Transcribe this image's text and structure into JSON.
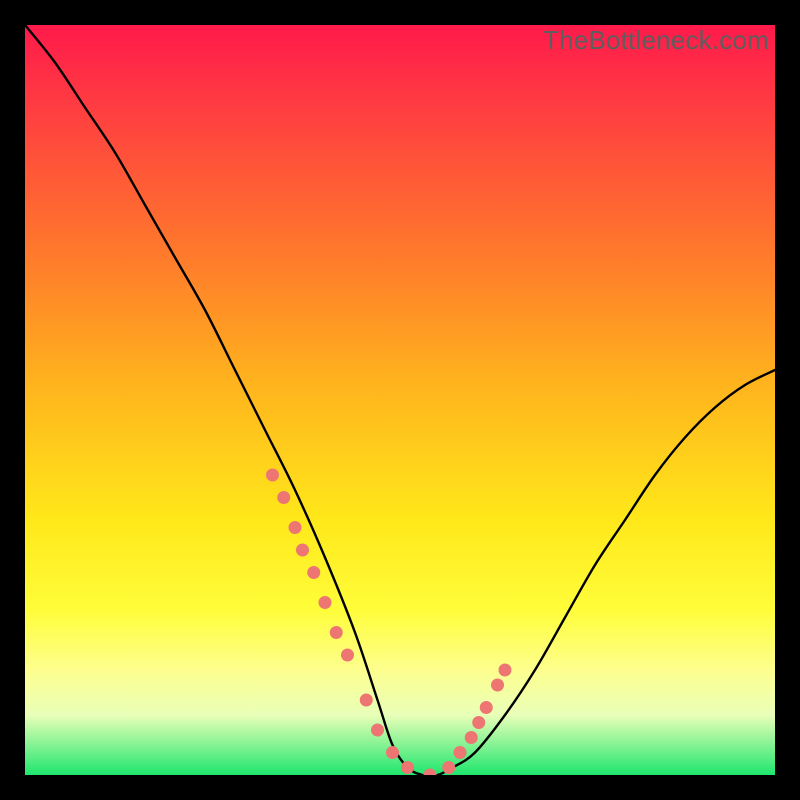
{
  "watermark": "TheBottleneck.com",
  "chart_data": {
    "type": "line",
    "title": "",
    "xlabel": "",
    "ylabel": "",
    "xlim": [
      0,
      100
    ],
    "ylim": [
      0,
      100
    ],
    "series": [
      {
        "name": "bottleneck-curve",
        "x": [
          0,
          4,
          8,
          12,
          16,
          20,
          24,
          28,
          32,
          36,
          40,
          44,
          47,
          49,
          51,
          53,
          55,
          57,
          60,
          64,
          68,
          72,
          76,
          80,
          84,
          88,
          92,
          96,
          100
        ],
        "values": [
          100,
          95,
          89,
          83,
          76,
          69,
          62,
          54,
          46,
          38,
          29,
          19,
          10,
          4,
          1,
          0,
          0,
          1,
          3,
          8,
          14,
          21,
          28,
          34,
          40,
          45,
          49,
          52,
          54
        ]
      }
    ],
    "markers": {
      "name": "highlight-dots",
      "color": "#ed7672",
      "x": [
        33,
        34.5,
        36,
        37,
        38.5,
        40,
        41.5,
        43,
        45.5,
        47,
        49,
        51,
        54,
        56.5,
        58,
        59.5,
        60.5,
        61.5,
        63,
        64
      ],
      "values": [
        40,
        37,
        33,
        30,
        27,
        23,
        19,
        16,
        10,
        6,
        3,
        1,
        0,
        1,
        3,
        5,
        7,
        9,
        12,
        14
      ]
    },
    "background_gradient": {
      "direction": "top-to-bottom",
      "stops": [
        {
          "pos": 0.0,
          "color": "#ff1a4b"
        },
        {
          "pos": 0.12,
          "color": "#ff4040"
        },
        {
          "pos": 0.32,
          "color": "#ff7e2a"
        },
        {
          "pos": 0.48,
          "color": "#ffb41d"
        },
        {
          "pos": 0.66,
          "color": "#ffe81a"
        },
        {
          "pos": 0.78,
          "color": "#fffd3a"
        },
        {
          "pos": 0.86,
          "color": "#fdff8e"
        },
        {
          "pos": 0.92,
          "color": "#e9ffb8"
        },
        {
          "pos": 1.0,
          "color": "#1ee66e"
        }
      ]
    }
  }
}
